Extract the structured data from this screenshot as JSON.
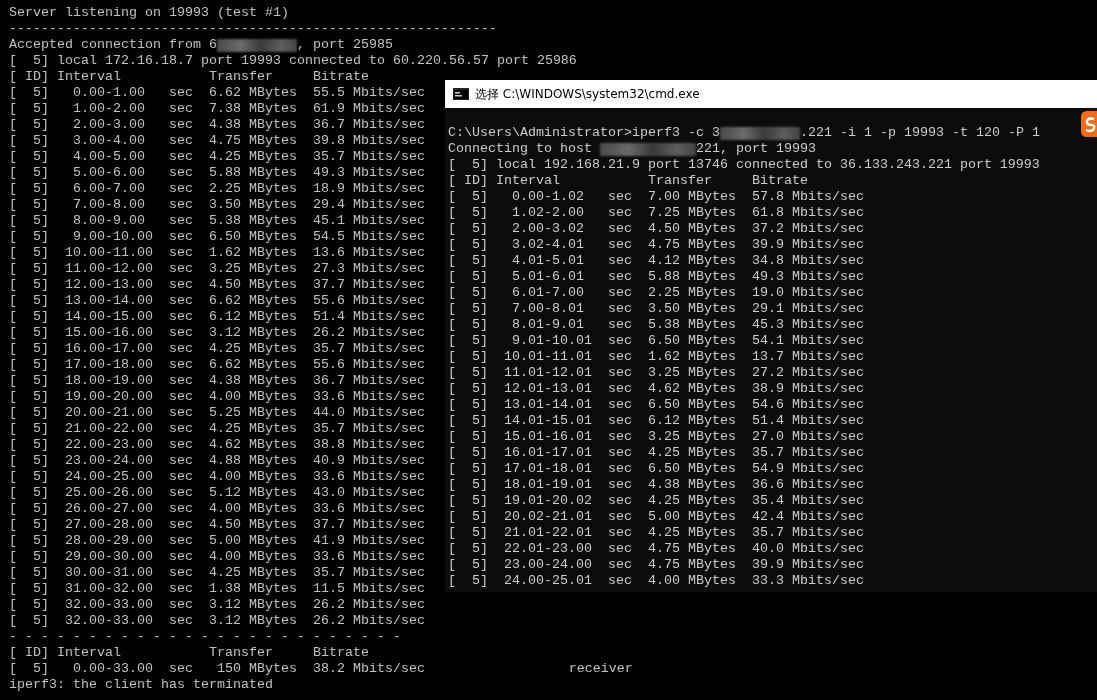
{
  "background_terminal": {
    "lines": [
      {
        "kind": "text",
        "text": "Server listening on 19993 (test #1)"
      },
      {
        "kind": "text",
        "text": "-------------------------------------------------------------"
      },
      {
        "kind": "redacted",
        "before": "Accepted connection from 6",
        "after": ", port 25985"
      },
      {
        "kind": "text",
        "text": "[  5] local 172.16.18.7 port 19993 connected to 60.220.56.57 port 25986"
      },
      {
        "kind": "text",
        "text": "[ ID] Interval           Transfer     Bitrate"
      },
      {
        "kind": "text",
        "text": "[  5]   0.00-1.00   sec  6.62 MBytes  55.5 Mbits/sec"
      },
      {
        "kind": "text",
        "text": "[  5]   1.00-2.00   sec  7.38 MBytes  61.9 Mbits/sec"
      },
      {
        "kind": "text",
        "text": "[  5]   2.00-3.00   sec  4.38 MBytes  36.7 Mbits/sec"
      },
      {
        "kind": "text",
        "text": "[  5]   3.00-4.00   sec  4.75 MBytes  39.8 Mbits/sec"
      },
      {
        "kind": "text",
        "text": "[  5]   4.00-5.00   sec  4.25 MBytes  35.7 Mbits/sec"
      },
      {
        "kind": "text",
        "text": "[  5]   5.00-6.00   sec  5.88 MBytes  49.3 Mbits/sec"
      },
      {
        "kind": "text",
        "text": "[  5]   6.00-7.00   sec  2.25 MBytes  18.9 Mbits/sec"
      },
      {
        "kind": "text",
        "text": "[  5]   7.00-8.00   sec  3.50 MBytes  29.4 Mbits/sec"
      },
      {
        "kind": "text",
        "text": "[  5]   8.00-9.00   sec  5.38 MBytes  45.1 Mbits/sec"
      },
      {
        "kind": "text",
        "text": "[  5]   9.00-10.00  sec  6.50 MBytes  54.5 Mbits/sec"
      },
      {
        "kind": "text",
        "text": "[  5]  10.00-11.00  sec  1.62 MBytes  13.6 Mbits/sec"
      },
      {
        "kind": "text",
        "text": "[  5]  11.00-12.00  sec  3.25 MBytes  27.3 Mbits/sec"
      },
      {
        "kind": "text",
        "text": "[  5]  12.00-13.00  sec  4.50 MBytes  37.7 Mbits/sec"
      },
      {
        "kind": "text",
        "text": "[  5]  13.00-14.00  sec  6.62 MBytes  55.6 Mbits/sec"
      },
      {
        "kind": "text",
        "text": "[  5]  14.00-15.00  sec  6.12 MBytes  51.4 Mbits/sec"
      },
      {
        "kind": "text",
        "text": "[  5]  15.00-16.00  sec  3.12 MBytes  26.2 Mbits/sec"
      },
      {
        "kind": "text",
        "text": "[  5]  16.00-17.00  sec  4.25 MBytes  35.7 Mbits/sec"
      },
      {
        "kind": "text",
        "text": "[  5]  17.00-18.00  sec  6.62 MBytes  55.6 Mbits/sec"
      },
      {
        "kind": "text",
        "text": "[  5]  18.00-19.00  sec  4.38 MBytes  36.7 Mbits/sec"
      },
      {
        "kind": "text",
        "text": "[  5]  19.00-20.00  sec  4.00 MBytes  33.6 Mbits/sec"
      },
      {
        "kind": "text",
        "text": "[  5]  20.00-21.00  sec  5.25 MBytes  44.0 Mbits/sec"
      },
      {
        "kind": "text",
        "text": "[  5]  21.00-22.00  sec  4.25 MBytes  35.7 Mbits/sec"
      },
      {
        "kind": "text",
        "text": "[  5]  22.00-23.00  sec  4.62 MBytes  38.8 Mbits/sec"
      },
      {
        "kind": "text",
        "text": "[  5]  23.00-24.00  sec  4.88 MBytes  40.9 Mbits/sec"
      },
      {
        "kind": "text",
        "text": "[  5]  24.00-25.00  sec  4.00 MBytes  33.6 Mbits/sec"
      },
      {
        "kind": "text",
        "text": "[  5]  25.00-26.00  sec  5.12 MBytes  43.0 Mbits/sec"
      },
      {
        "kind": "text",
        "text": "[  5]  26.00-27.00  sec  4.00 MBytes  33.6 Mbits/sec"
      },
      {
        "kind": "text",
        "text": "[  5]  27.00-28.00  sec  4.50 MBytes  37.7 Mbits/sec"
      },
      {
        "kind": "text",
        "text": "[  5]  28.00-29.00  sec  5.00 MBytes  41.9 Mbits/sec"
      },
      {
        "kind": "text",
        "text": "[  5]  29.00-30.00  sec  4.00 MBytes  33.6 Mbits/sec"
      },
      {
        "kind": "text",
        "text": "[  5]  30.00-31.00  sec  4.25 MBytes  35.7 Mbits/sec"
      },
      {
        "kind": "text",
        "text": "[  5]  31.00-32.00  sec  1.38 MBytes  11.5 Mbits/sec"
      },
      {
        "kind": "text",
        "text": "[  5]  32.00-33.00  sec  3.12 MBytes  26.2 Mbits/sec"
      },
      {
        "kind": "text",
        "text": "[  5]  32.00-33.00  sec  3.12 MBytes  26.2 Mbits/sec"
      },
      {
        "kind": "text",
        "text": "- - - - - - - - - - - - - - - - - - - - - - - - -"
      },
      {
        "kind": "text",
        "text": "[ ID] Interval           Transfer     Bitrate"
      },
      {
        "kind": "text",
        "text": "[  5]   0.00-33.00  sec   150 MBytes  38.2 Mbits/sec                  receiver"
      },
      {
        "kind": "text",
        "text": "iperf3: the client has terminated"
      }
    ]
  },
  "cmd_window": {
    "title": "选择 C:\\WINDOWS\\system32\\cmd.exe",
    "lines": [
      {
        "kind": "redacted",
        "before": "C:\\Users\\Administrator>iperf3 -c 3",
        "after": ".221 -i 1 -p 19993 -t 120 -P 1"
      },
      {
        "kind": "redacted",
        "before": "Connecting to host ",
        "after": "221, port 19993"
      },
      {
        "kind": "text",
        "text": "[  5] local 192.168.21.9 port 13746 connected to 36.133.243.221 port 19993"
      },
      {
        "kind": "text",
        "text": "[ ID] Interval           Transfer     Bitrate"
      },
      {
        "kind": "text",
        "text": "[  5]   0.00-1.02   sec  7.00 MBytes  57.8 Mbits/sec"
      },
      {
        "kind": "text",
        "text": "[  5]   1.02-2.00   sec  7.25 MBytes  61.8 Mbits/sec"
      },
      {
        "kind": "text",
        "text": "[  5]   2.00-3.02   sec  4.50 MBytes  37.2 Mbits/sec"
      },
      {
        "kind": "text",
        "text": "[  5]   3.02-4.01   sec  4.75 MBytes  39.9 Mbits/sec"
      },
      {
        "kind": "text",
        "text": "[  5]   4.01-5.01   sec  4.12 MBytes  34.8 Mbits/sec"
      },
      {
        "kind": "text",
        "text": "[  5]   5.01-6.01   sec  5.88 MBytes  49.3 Mbits/sec"
      },
      {
        "kind": "text",
        "text": "[  5]   6.01-7.00   sec  2.25 MBytes  19.0 Mbits/sec"
      },
      {
        "kind": "text",
        "text": "[  5]   7.00-8.01   sec  3.50 MBytes  29.1 Mbits/sec"
      },
      {
        "kind": "text",
        "text": "[  5]   8.01-9.01   sec  5.38 MBytes  45.3 Mbits/sec"
      },
      {
        "kind": "text",
        "text": "[  5]   9.01-10.01  sec  6.50 MBytes  54.1 Mbits/sec"
      },
      {
        "kind": "text",
        "text": "[  5]  10.01-11.01  sec  1.62 MBytes  13.7 Mbits/sec"
      },
      {
        "kind": "text",
        "text": "[  5]  11.01-12.01  sec  3.25 MBytes  27.2 Mbits/sec"
      },
      {
        "kind": "text",
        "text": "[  5]  12.01-13.01  sec  4.62 MBytes  38.9 Mbits/sec"
      },
      {
        "kind": "text",
        "text": "[  5]  13.01-14.01  sec  6.50 MBytes  54.6 Mbits/sec"
      },
      {
        "kind": "text",
        "text": "[  5]  14.01-15.01  sec  6.12 MBytes  51.4 Mbits/sec"
      },
      {
        "kind": "text",
        "text": "[  5]  15.01-16.01  sec  3.25 MBytes  27.0 Mbits/sec"
      },
      {
        "kind": "text",
        "text": "[  5]  16.01-17.01  sec  4.25 MBytes  35.7 Mbits/sec"
      },
      {
        "kind": "text",
        "text": "[  5]  17.01-18.01  sec  6.50 MBytes  54.9 Mbits/sec"
      },
      {
        "kind": "text",
        "text": "[  5]  18.01-19.01  sec  4.38 MBytes  36.6 Mbits/sec"
      },
      {
        "kind": "text",
        "text": "[  5]  19.01-20.02  sec  4.25 MBytes  35.4 Mbits/sec"
      },
      {
        "kind": "text",
        "text": "[  5]  20.02-21.01  sec  5.00 MBytes  42.4 Mbits/sec"
      },
      {
        "kind": "text",
        "text": "[  5]  21.01-22.01  sec  4.25 MBytes  35.7 Mbits/sec"
      },
      {
        "kind": "text",
        "text": "[  5]  22.01-23.00  sec  4.75 MBytes  40.0 Mbits/sec"
      },
      {
        "kind": "text",
        "text": "[  5]  23.00-24.00  sec  4.75 MBytes  39.9 Mbits/sec"
      },
      {
        "kind": "text",
        "text": "[  5]  24.00-25.01  sec  4.00 MBytes  33.3 Mbits/sec"
      }
    ]
  }
}
